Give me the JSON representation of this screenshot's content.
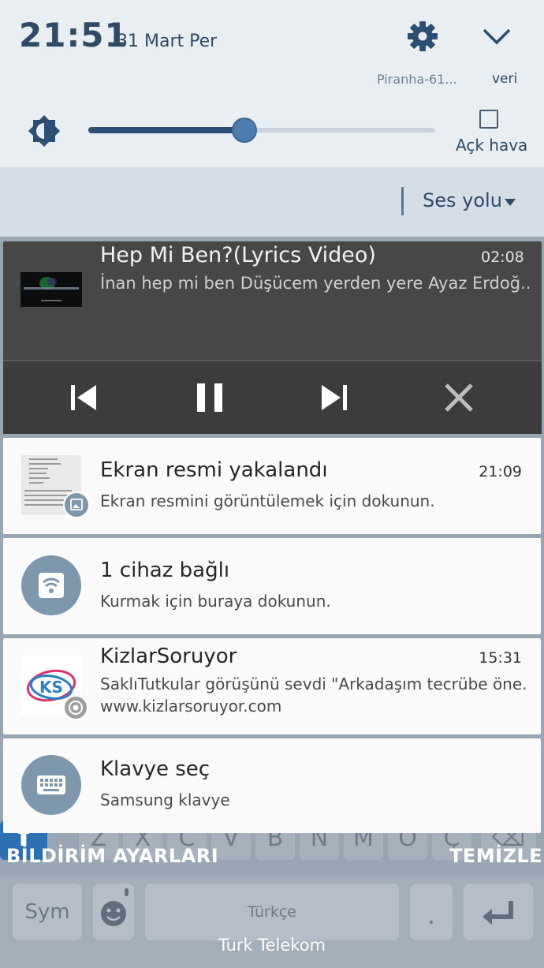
{
  "status": {
    "time": "21:51",
    "date": "31 Mart Per",
    "wifi_network": "Piranha-61...",
    "data_label": "veri"
  },
  "brightness": {
    "level_fraction": 0.45,
    "auto_label": "Açk hava"
  },
  "sound_path": {
    "label": "Ses yolu"
  },
  "media": {
    "title": "Hep Mi Ben?(Lyrics Video)",
    "time": "02:08",
    "subtitle": "İnan hep mi ben Düşücem yerden yere Ayaz Erdoğ..",
    "controls": [
      "previous-icon",
      "pause-icon",
      "next-icon",
      "close-icon"
    ]
  },
  "notifications": [
    {
      "title": "Ekran resmi yakalandı",
      "time": "21:09",
      "text": "Ekran resmini görüntülemek için dokunun.",
      "icon": "screenshot-thumbnail",
      "badge": "image-icon"
    },
    {
      "title": "1 cihaz bağlı",
      "text": "Kurmak için buraya dokunun.",
      "icon": "wifi-hotspot-icon"
    },
    {
      "title": "KizlarSoruyor",
      "time": "15:31",
      "text": "SaklıTutkular görüşünü sevdi \"Arkadaşım tecrübe öne...",
      "url": "www.kizlarsoruyor.com",
      "icon": "kizlarsoruyor-logo",
      "badge": "chrome-icon",
      "logo_text": "KS"
    },
    {
      "title": "Klavye seç",
      "text": "Samsung klavye",
      "icon": "keyboard-icon"
    }
  ],
  "footer": {
    "settings": "BİLDİRİM AYARLARI",
    "clear": "TEMİZLE"
  },
  "keyboard": {
    "letters": [
      "Z",
      "X",
      "C",
      "V",
      "B",
      "N",
      "M",
      "Ö",
      "Ç"
    ],
    "sym": "Sym",
    "space": "Türkçe",
    "period": "."
  },
  "carrier": "Turk Telekom",
  "colors": {
    "panel_bg": "#e9eef3",
    "accent": "#2e4a67",
    "slider": "#4e7db0",
    "media_bg": "#474747"
  }
}
